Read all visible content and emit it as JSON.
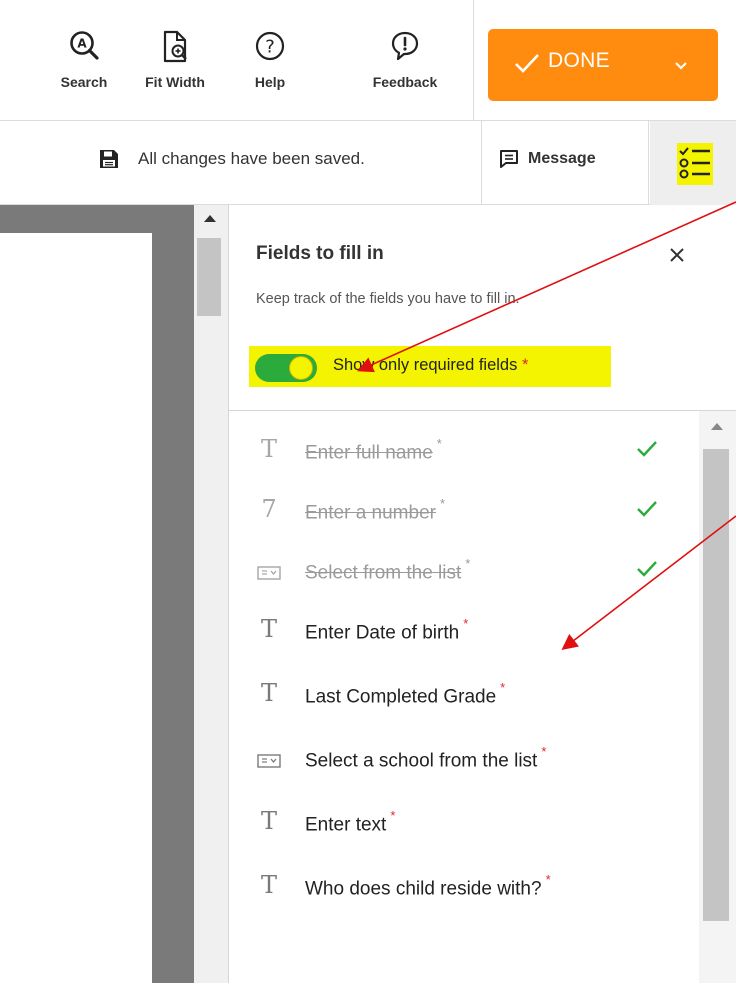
{
  "toolbar": {
    "tools": [
      {
        "label": "Search",
        "icon": "search-icon"
      },
      {
        "label": "Fit Width",
        "icon": "fit-width-icon"
      },
      {
        "label": "Help",
        "icon": "help-icon"
      },
      {
        "label": "Feedback",
        "icon": "feedback-icon"
      }
    ],
    "done_label": "DONE",
    "done_color": "#ff8c0f"
  },
  "statusbar": {
    "saved_text": "All changes have been saved.",
    "message_label": "Message",
    "highlight_color": "#f4f400"
  },
  "panel": {
    "title": "Fields to fill in",
    "subtitle": "Keep track of the fields you have to fill in.",
    "toggle_label": "Show only required fields",
    "toggle_on": true,
    "required_marker": "*",
    "toggle_color": "#2bab3b",
    "check_color": "#2bab3b",
    "fields": [
      {
        "label": "Enter full name",
        "icon": "text-field-icon",
        "completed": true
      },
      {
        "label": "Enter a number",
        "icon": "number-field-icon",
        "completed": true
      },
      {
        "label": "Select from the list",
        "icon": "dropdown-field-icon",
        "completed": true
      },
      {
        "label": "Enter Date of birth",
        "icon": "text-field-icon",
        "completed": false
      },
      {
        "label": "Last Completed Grade",
        "icon": "text-field-icon",
        "completed": false
      },
      {
        "label": "Select a school from the list",
        "icon": "dropdown-field-icon",
        "completed": false
      },
      {
        "label": "Enter text",
        "icon": "text-field-icon",
        "completed": false
      },
      {
        "label": "Who does child reside with?",
        "icon": "text-field-icon",
        "completed": false
      }
    ]
  },
  "annotations": {
    "arrow_color": "#e01010"
  }
}
